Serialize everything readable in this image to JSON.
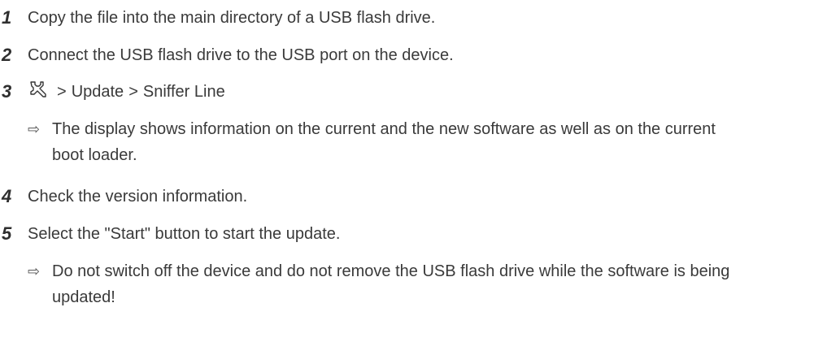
{
  "steps": [
    {
      "number": "1",
      "text": "Copy the file into the main directory of a USB flash drive."
    },
    {
      "number": "2",
      "text": "Connect the USB flash drive to the USB port on the device."
    },
    {
      "number": "3",
      "path": {
        "icon": "wrench-icon",
        "separator": ">",
        "items": [
          "Update",
          "Sniffer Line"
        ]
      }
    },
    {
      "number": "4",
      "text": "Check the version information."
    },
    {
      "number": "5",
      "text": "Select the \"Start\" button to start the update."
    }
  ],
  "results": [
    {
      "arrow": "⇨",
      "text": "The display shows information on the current and the new software as well as on the current boot loader."
    },
    {
      "arrow": "⇨",
      "text": "Do not switch off the device and do not remove the USB flash drive while the software is being updated!"
    }
  ]
}
